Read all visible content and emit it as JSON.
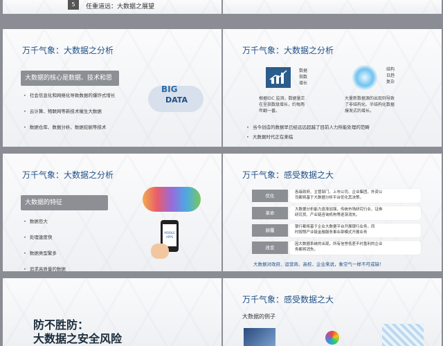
{
  "slide_top_left": {
    "number": "5",
    "text": "任重道远：大数据之展望"
  },
  "slide1": {
    "title": "万千气象：大数据之分析",
    "bar": "大数据的核心是数据、技术和思维：",
    "bullets": [
      "社会信息化和网络化导致数据的爆炸式增长",
      "云计算、物联网等新技术催生大数据",
      "数据仓库、数据分析、数据挖掘等技术"
    ],
    "cloud_words": [
      "BIG",
      "DATA"
    ]
  },
  "slide2": {
    "title": "万千气象：大数据之分析",
    "icon1_words": [
      "数据",
      "指数",
      "增长"
    ],
    "icon2_words": [
      "结构",
      "日趋",
      "复杂"
    ],
    "text1": [
      "根据IDC 监测，数据量正",
      "在呈指数级增长，约每两",
      "年翻一番。"
    ],
    "text2": [
      "大量新数据源的出现则导致",
      "了非结构化、半结构化数据",
      "爆发式的增长。"
    ],
    "bullets": [
      "当今创造的数据早已经远远超越了目前人力所能处理的范畴",
      "大数据时代正在来临"
    ]
  },
  "slide3": {
    "title": "万千气象：大数据之分析",
    "bar": "大数据的特征",
    "bullets": [
      "数据巨大",
      "处理速度快",
      "数据类型繁多",
      "追求高质量的数据"
    ],
    "phone_text": [
      "MOBILE",
      "APPS"
    ]
  },
  "slide4": {
    "title": "万千气象：感受数据之大",
    "rows": [
      {
        "label": "优化",
        "text": [
          "各级政府、主管部门、上市公司、企业集团、外资公",
          "司都将基于大数据分析平台优化其决策。"
        ]
      },
      {
        "label": "革命",
        "text": [
          "大数据分析能力逐渐加强，传统市场研究行业、证券",
          "研究员、产业链咨询机构等逐渐消失。"
        ]
      },
      {
        "label": "颠覆",
        "text": [
          "银行都将基于企业大数据平台开展银行业务，同",
          "时按照产业链金融服务事业部模式开展业务"
        ]
      },
      {
        "label": "改变",
        "text": [
          "因大数据系统的出现，所有信誉低差不衬盈利的企业",
          "务都将消失。"
        ]
      }
    ],
    "footer": "大数据对政府、运营商、高校、企业来说，象空气一样不可或缺！"
  },
  "slide5": {
    "title_line1": "防不胜防：",
    "title_line2": "大数据之安全风险"
  },
  "slide6": {
    "title": "万千气象：感受数据之大",
    "subtitle": "大数据的例子"
  }
}
